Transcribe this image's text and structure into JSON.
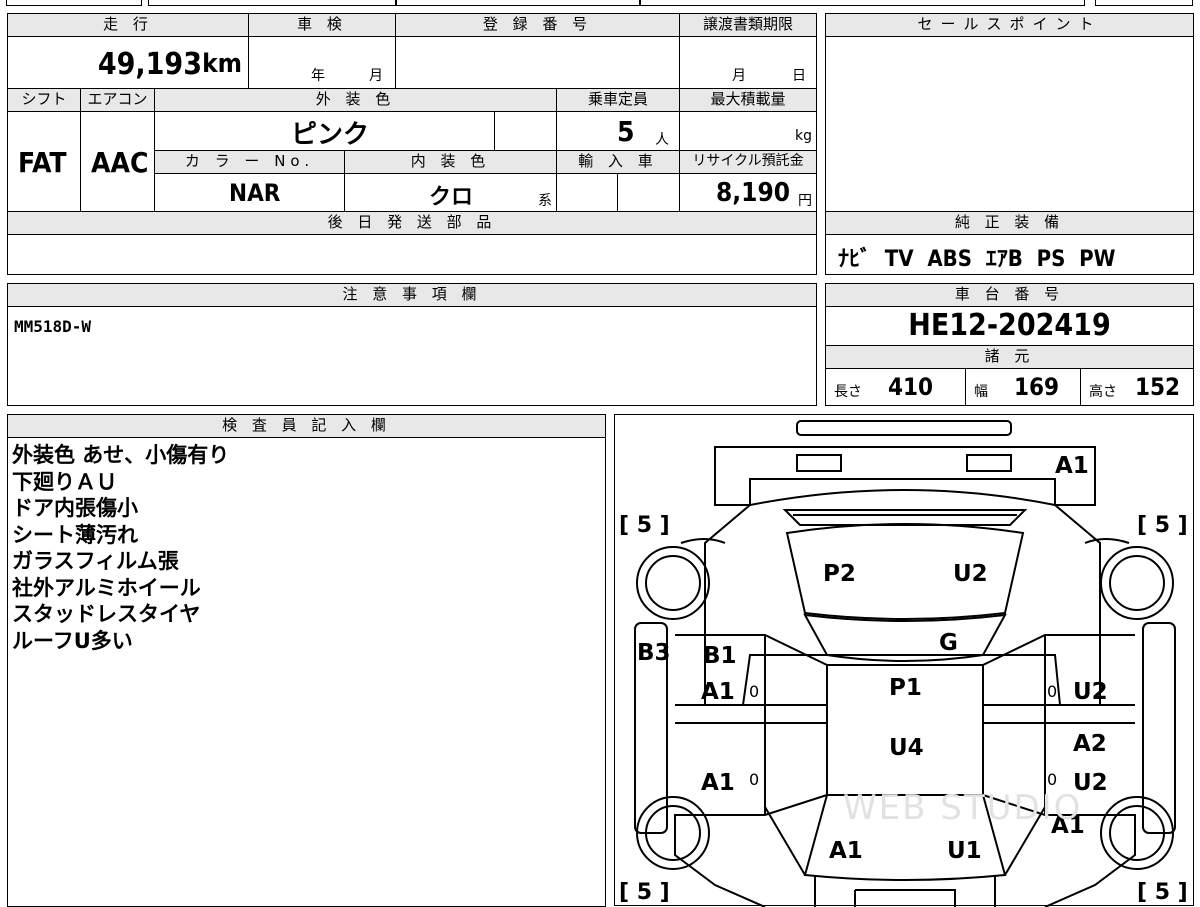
{
  "sheet": {
    "mileage": {
      "header": "走 行",
      "value": "49,193",
      "unit": "km"
    },
    "inspection": {
      "header": "車 検",
      "year": "年",
      "month": "月"
    },
    "registration": {
      "header": "登 録 番 号"
    },
    "transfer_deadline": {
      "header": "譲渡書類期限",
      "month": "月",
      "day": "日"
    },
    "shift": {
      "header": "シフト",
      "value": "FAT"
    },
    "aircon": {
      "header": "エアコン",
      "value": "AAC"
    },
    "exterior_color": {
      "header": "外 装 色",
      "value": "ピンク"
    },
    "capacity": {
      "header": "乗車定員",
      "value": "5",
      "unit": "人"
    },
    "max_load": {
      "header": "最大積載量",
      "unit": "kg"
    },
    "color_no": {
      "header": "カ ラ ー No.",
      "value": "NAR"
    },
    "interior_color": {
      "header": "内 装 色",
      "value": "クロ",
      "suffix": "系"
    },
    "import": {
      "header": "輸 入 車"
    },
    "recycle": {
      "header": "リサイクル預託金",
      "value": "8,190",
      "unit": "円"
    },
    "later_parts": {
      "header": "後 日 発 送 部 品"
    },
    "sales_point": {
      "header": "セールスポイント"
    },
    "genuine_equipment": {
      "header": "純 正 装 備",
      "value": "ﾅﾋﾞ  TV  ABS  ｴｱB  PS  PW"
    },
    "notes": {
      "header": "注 意 事 項 欄",
      "value": "MM518D-W"
    },
    "chassis_no": {
      "header": "車 台 番 号",
      "value": "HE12-202419"
    },
    "specs": {
      "header": "諸 元",
      "length_label": "長さ",
      "length": "410",
      "width_label": "幅",
      "width": "169",
      "height_label": "高さ",
      "height": "152"
    },
    "inspector": {
      "header": "検 査 員 記 入 欄",
      "lines": [
        "外装色 あせ、小傷有り",
        "下廻りＡＵ",
        "ドア内張傷小",
        "シート薄汚れ",
        "ガラスフィルム張",
        "社外アルミホイール",
        "スタッドレスタイヤ",
        "ルーフU多い"
      ]
    }
  },
  "diagram": {
    "tires": [
      "[ 5 ]",
      "[ 5 ]",
      "[ 5 ]",
      "[ 5 ]"
    ],
    "marks": [
      "A1",
      "P2",
      "U2",
      "G",
      "B3",
      "B1",
      "A1",
      "P1",
      "U2",
      "U4",
      "A2",
      "A1",
      "U2",
      "A1",
      "A1",
      "U1"
    ],
    "zeros": [
      "0",
      "0",
      "0",
      "0"
    ],
    "watermark": "WEB STUDIO"
  }
}
